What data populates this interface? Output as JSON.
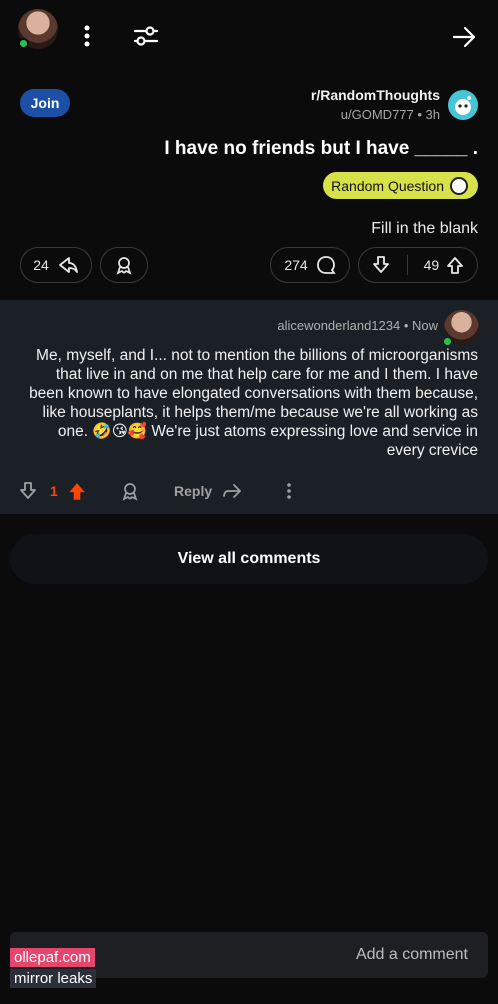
{
  "topbar": {
    "menu_icon": "more-vertical-icon",
    "filter_icon": "sliders-icon",
    "forward_icon": "arrow-right-icon"
  },
  "post": {
    "join_label": "Join",
    "subreddit": "r/RandomThoughts",
    "meta": "u/GOMD777 • 3h",
    "title": "I have no friends but I have _____ .",
    "flair": "Random Question",
    "body": "Fill in the blank",
    "upvotes": "49",
    "comments": "274",
    "shares": "24"
  },
  "comment": {
    "user": "alicewonderland1234 • Now",
    "text": "Me, myself, and I... not to mention the billions of microorganisms that live in and on me that help care for me and I them. I have been known to have elongated conversations with them because, like houseplants, it helps them/me because we're all working as one. 🤣😘🥰 We're just atoms expressing love and service in every crevice",
    "reply_label": "Reply",
    "score": "1"
  },
  "view_all_label": "View all comments",
  "add_comment_placeholder": "Add a comment",
  "watermark": {
    "line1": "ollepaf.com",
    "line2": "mirror leaks"
  },
  "colors": {
    "accent_upvote": "#ff4500",
    "join_button": "#1e4fa6",
    "flair_bg": "#d7e24a",
    "online": "#2fbf4f"
  }
}
